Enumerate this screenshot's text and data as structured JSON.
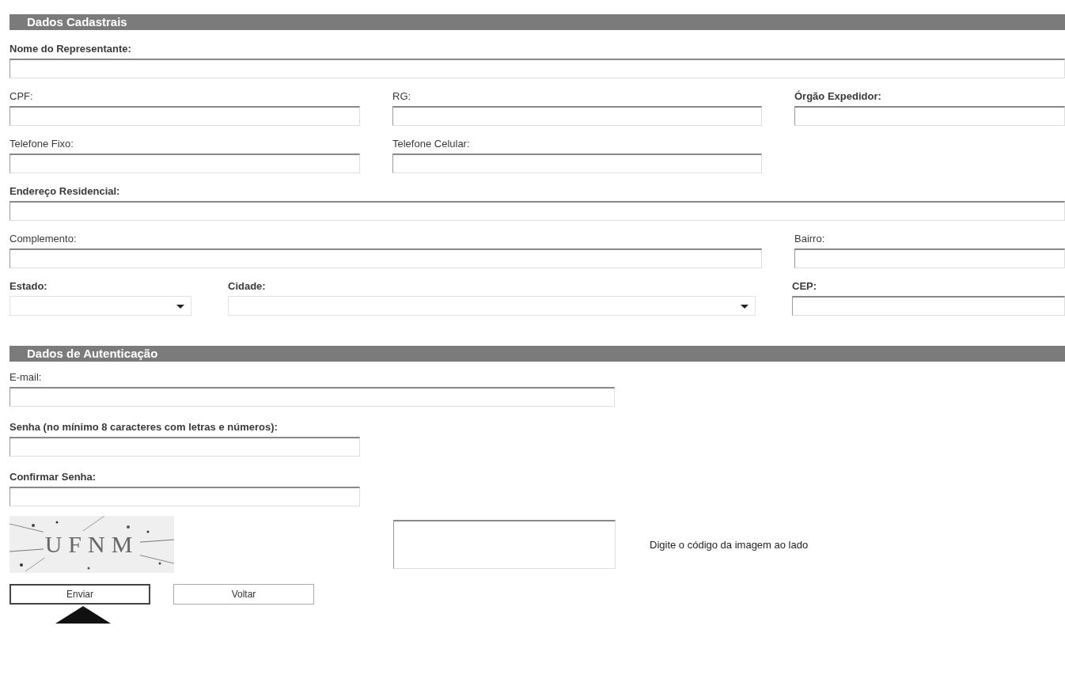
{
  "sections": [
    {
      "title": "Dados Cadastrais",
      "rows": [
        [
          {
            "label": "Nome do Representante:",
            "bold": true,
            "kind": "text"
          }
        ],
        [
          {
            "label": "CPF:",
            "bold": false,
            "kind": "text"
          },
          {
            "label": "RG:",
            "bold": false,
            "kind": "text"
          },
          {
            "label": "Órgão Expedidor:",
            "bold": true,
            "kind": "text"
          }
        ],
        [
          {
            "label": "Telefone Fixo:",
            "bold": false,
            "kind": "text"
          },
          {
            "label": "Telefone Celular:",
            "bold": false,
            "kind": "text"
          }
        ],
        [
          {
            "label": "Endereço Residencial:",
            "bold": true,
            "kind": "text"
          }
        ],
        [
          {
            "label": "Complemento:",
            "bold": false,
            "kind": "text"
          },
          "",
          {
            "label": "Bairro:",
            "bold": false,
            "kind": "text"
          }
        ],
        [
          {
            "label": "Estado:",
            "bold": true,
            "kind": "select"
          },
          {
            "label": "Cidade:",
            "bold": true,
            "kind": "select"
          },
          {
            "label": "CEP:",
            "bold": true,
            "kind": "text"
          }
        ]
      ]
    },
    {
      "title": "Dados de Autenticação",
      "rows": [
        [
          {
            "label": "E-mail:",
            "bold": false,
            "kind": "text"
          }
        ],
        [
          {
            "label": "Senha (no mínimo 8 caracteres com letras e números):",
            "bold": true,
            "kind": "text"
          }
        ],
        [
          {
            "label": "Confirmar Senha:",
            "bold": true,
            "kind": "text"
          }
        ]
      ]
    }
  ],
  "captcha": {
    "code": "UFNM",
    "hint": "Digite o código da imagem ao lado"
  },
  "buttons": [
    {
      "label": "Enviar",
      "selected": true
    },
    {
      "label": "Voltar",
      "selected": false
    }
  ]
}
